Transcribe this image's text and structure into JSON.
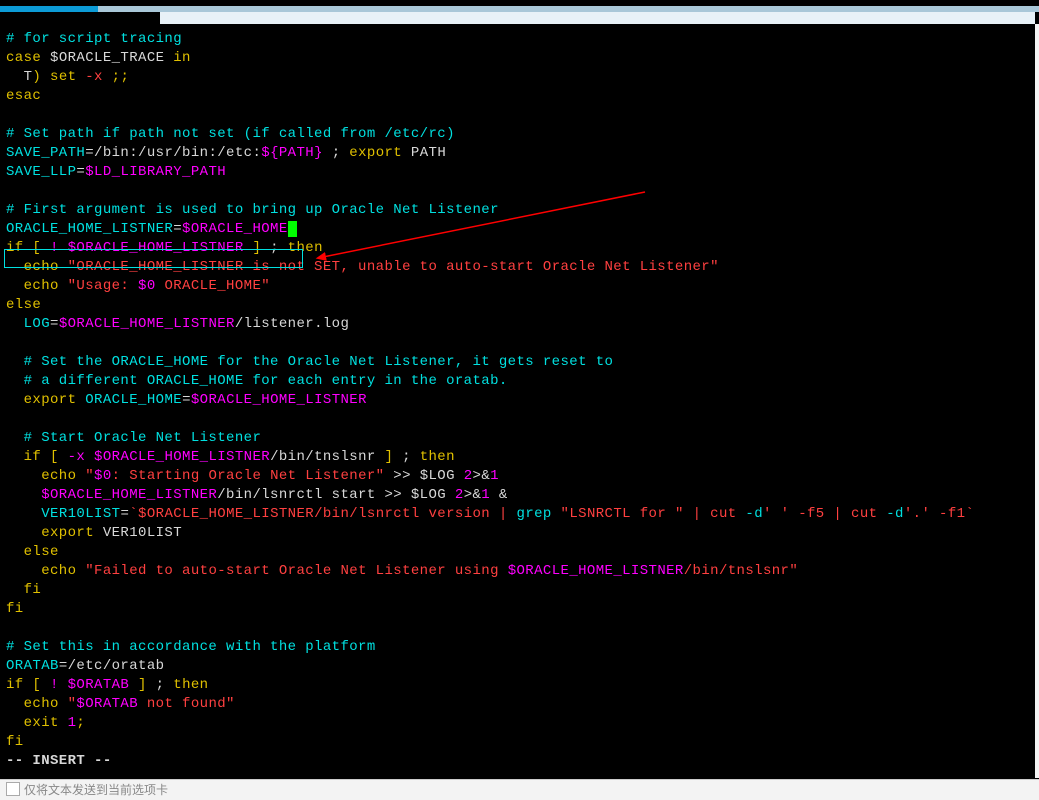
{
  "mode_line": "-- INSERT --",
  "bottom_bar": {
    "checkbox_label": "仅将文本发送到当前选项卡"
  },
  "highlighted_line": {
    "var": "ORACLE_HOME_LISTNER",
    "eq": "=",
    "val": "$ORACLE_HOME"
  },
  "c": {
    "l1": "# for script tracing",
    "l2a": "case",
    "l2b": " $ORACLE_TRACE ",
    "l2c": "in",
    "l3a": "  T",
    "l3b": ")",
    "l3c": " set",
    "l3d": " -x ",
    "l3e": ";;",
    "l4": "esac",
    "l6": "# Set path if path not set (if called from /etc/rc)",
    "l7a": "SAVE_PATH",
    "l7b": "=",
    "l7c": "/bin:/usr/bin:/etc:",
    "l7d": "${PATH}",
    "l7e": " ; ",
    "l7f": "export",
    "l7g": " PATH",
    "l8a": "SAVE_LLP",
    "l8b": "=",
    "l8c": "$LD_LIBRARY_PATH",
    "l10": "# First argument is used to bring up Oracle Net Listener",
    "l12a": "if",
    "l12b": " [",
    "l12c": " ! $ORACLE_HOME_LISTNER ",
    "l12d": "]",
    "l12e": " ; ",
    "l12f": "then",
    "l13a": "  echo",
    "l13b": " \"ORACLE_HOME_LISTNER is not SET, unable to auto-start Oracle Net Listener\"",
    "l14a": "  echo",
    "l14b": " \"Usage: ",
    "l14c": "$0",
    "l14d": " ORACLE_HOME\"",
    "l15": "else",
    "l16a": "  ",
    "l16b": "LOG",
    "l16c": "=",
    "l16d": "$ORACLE_HOME_LISTNER",
    "l16e": "/listener.log",
    "l18": "  # Set the ORACLE_HOME for the Oracle Net Listener, it gets reset to",
    "l19": "  # a different ORACLE_HOME for each entry in the oratab.",
    "l20a": "  export",
    "l20b": " ",
    "l20c": "ORACLE_HOME",
    "l20d": "=",
    "l20e": "$ORACLE_HOME_LISTNER",
    "l22": "  # Start Oracle Net Listener",
    "l23a": "  if",
    "l23b": " [",
    "l23c": " -x $ORACLE_HOME_LISTNER",
    "l23d": "/bin/tnslsnr ",
    "l23e": "]",
    "l23f": " ; ",
    "l23g": "then",
    "l24a": "    echo",
    "l24b": " \"",
    "l24c": "$0",
    "l24d": ": Starting Oracle Net Listener\"",
    "l24e": " >> $LOG ",
    "l24f": "2",
    "l24g": ">&",
    "l24h": "1",
    "l25a": "    $ORACLE_HOME_LISTNER",
    "l25b": "/bin/lsnrctl start >> $LOG ",
    "l25c": "2",
    "l25d": ">&",
    "l25e": "1",
    "l25f": " &",
    "l26a": "    ",
    "l26b": "VER10LIST",
    "l26c": "=",
    "l26d": "`$ORACLE_HOME_LISTNER/bin/lsnrctl version | ",
    "l26e": "grep",
    "l26f": " \"LSNRCTL for \"",
    "l26g": " | cut ",
    "l26h": "-d",
    "l26i": "' '",
    "l26j": " -f5 ",
    "l26k": "| cut ",
    "l26l": "-d",
    "l26m": "'.'",
    "l26n": " -f1`",
    "l27a": "    export",
    "l27b": " VER10LIST",
    "l28": "  else",
    "l29a": "    echo",
    "l29b": " \"Failed to auto-start Oracle Net Listener using ",
    "l29c": "$ORACLE_HOME_LISTNER",
    "l29d": "/bin/tnslsnr\"",
    "l30": "  fi",
    "l31": "fi",
    "l33": "# Set this in accordance with the platform",
    "l34a": "ORATAB",
    "l34b": "=",
    "l34c": "/etc/oratab",
    "l35a": "if",
    "l35b": " [",
    "l35c": " ! $ORATAB ",
    "l35d": "]",
    "l35e": " ; ",
    "l35f": "then",
    "l36a": "  echo",
    "l36b": " \"",
    "l36c": "$ORATAB",
    "l36d": " not found\"",
    "l37a": "  exit",
    "l37b": " 1",
    "l37c": ";",
    "l38": "fi"
  }
}
